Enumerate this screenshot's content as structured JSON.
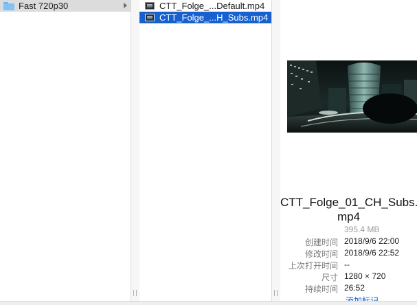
{
  "column1": {
    "items": [
      {
        "label": "Fast 720p30",
        "icon": "folder-icon",
        "selected": true
      }
    ]
  },
  "column2": {
    "items": [
      {
        "label": "CTT_Folge_...Default.mp4",
        "icon": "video-file-icon",
        "selected": false
      },
      {
        "label": "CTT_Folge_...H_Subs.mp4",
        "icon": "video-file-icon",
        "selected": true
      }
    ]
  },
  "preview": {
    "filename_line1": "CTT_Folge_01_CH_Subs.",
    "filename_line2": "mp4",
    "size": "395.4 MB",
    "meta": [
      {
        "key": "创建时间",
        "value": "2018/9/6 22:00"
      },
      {
        "key": "修改时间",
        "value": "2018/9/6 22:52"
      },
      {
        "key": "上次打开时间",
        "value": "--"
      },
      {
        "key": "尺寸",
        "value": "1280 × 720"
      },
      {
        "key": "持续时间",
        "value": "26:52"
      }
    ],
    "add_tags": "添加标记..."
  },
  "colors": {
    "selection": "#1660d0",
    "folder": "#7ec2f7",
    "link": "#1660d0"
  }
}
